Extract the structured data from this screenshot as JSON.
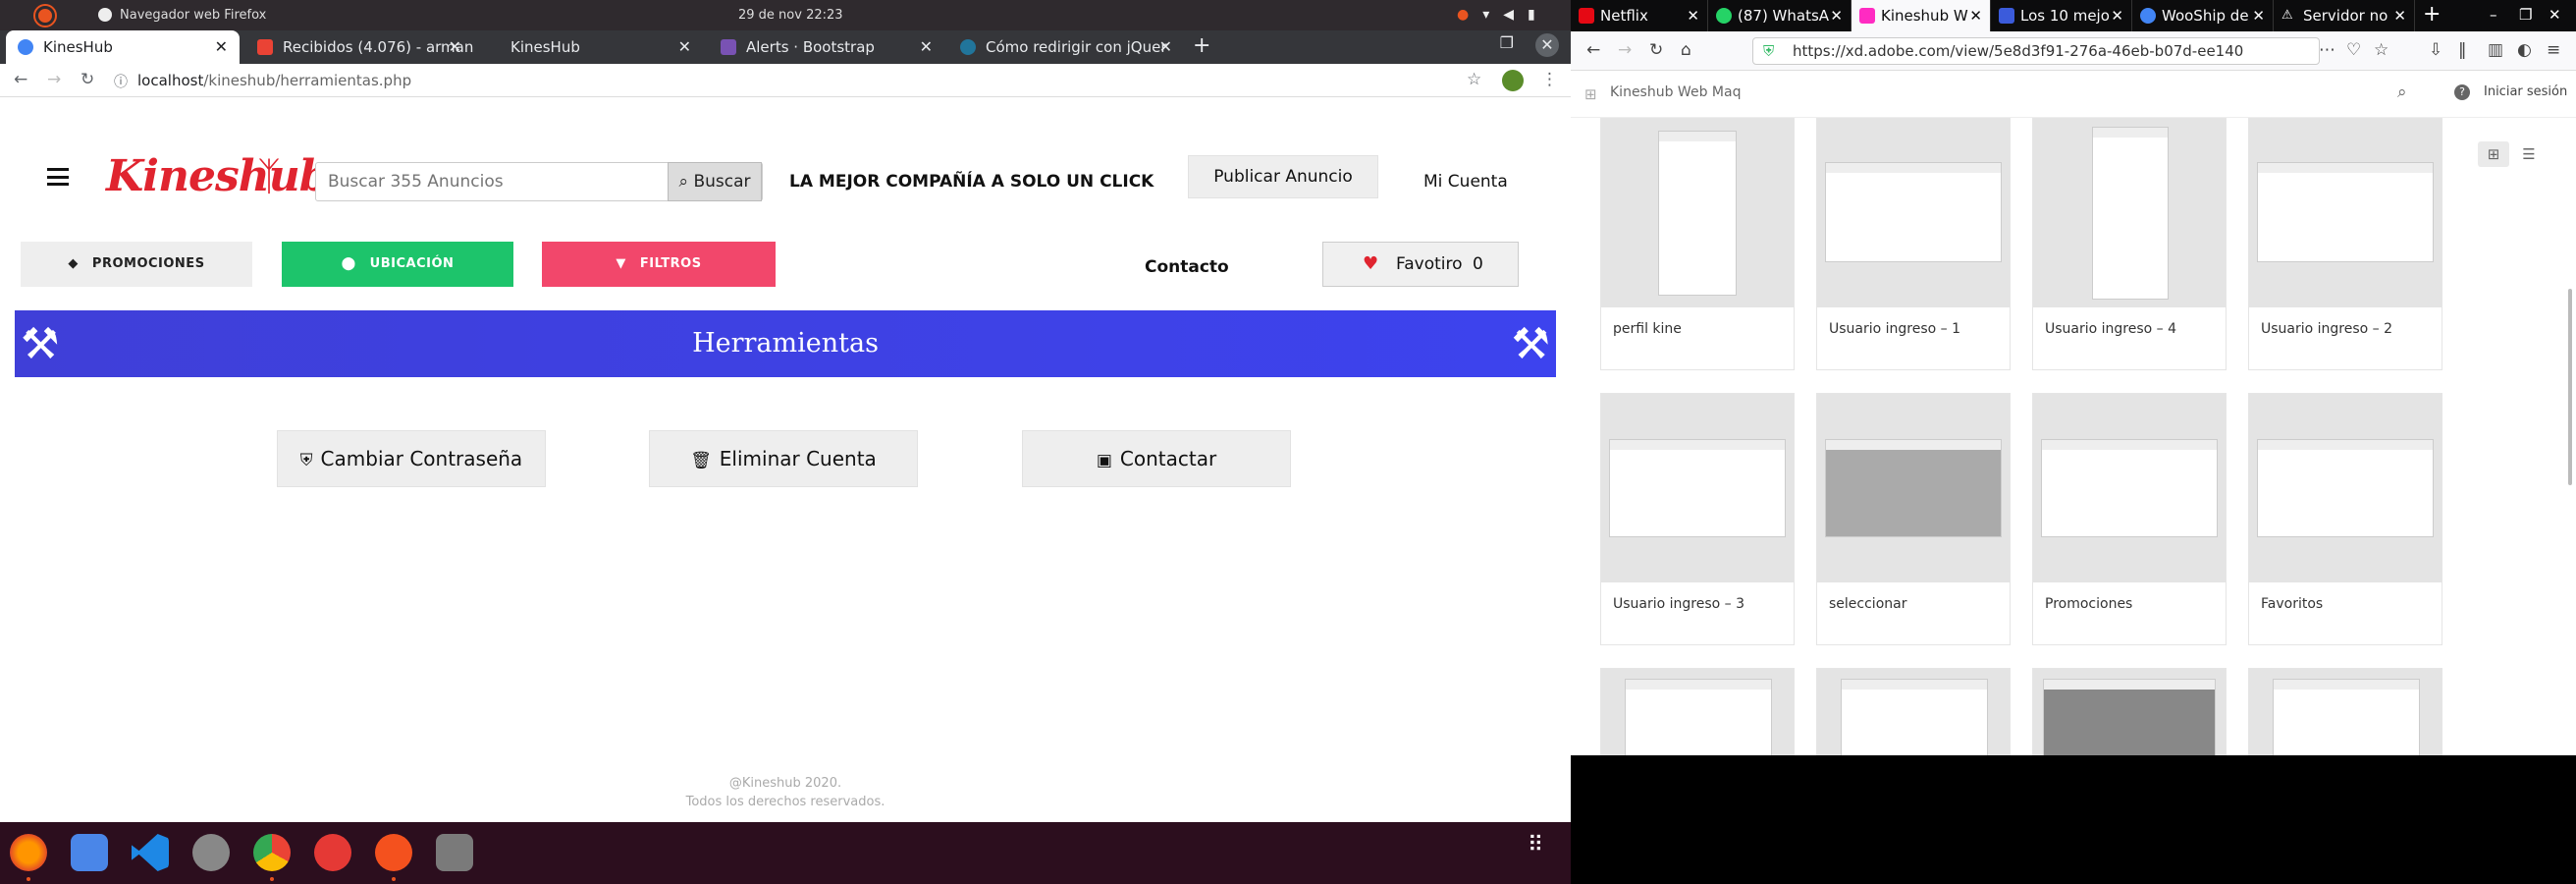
{
  "os": {
    "window_title": "Navegador web Firefox",
    "clock": "29 de nov  22:23"
  },
  "chrome": {
    "tabs": [
      {
        "label": "KinesHub",
        "color": "#4285f4",
        "active": true
      },
      {
        "label": "Recibidos (4.076) - arman",
        "color": "#ea4335"
      },
      {
        "label": "KinesHub",
        "color": "#666"
      },
      {
        "label": "Alerts · Bootstrap",
        "color": "#7952b3"
      },
      {
        "label": "Cómo redirigir con jQuer",
        "color": "#21759b"
      }
    ],
    "url_host": "localhost",
    "url_path": "/kineshub/herramientas.php"
  },
  "site": {
    "logo": "Kineshub",
    "search_placeholder": "Buscar 355 Anuncios",
    "search_button": "Buscar",
    "slogan": "LA MEJOR COMPAÑÍA A SOLO UN CLICK",
    "publish_button": "Publicar Anuncio",
    "account_link": "Mi Cuenta",
    "promo_button": "PROMOCIONES",
    "location_button": "UBICACIÓN",
    "filters_button": "FILTROS",
    "contact_link": "Contacto",
    "favorites_label": "Favotiro",
    "favorites_count": "0",
    "banner_title": "Herramientas",
    "actions": [
      "Cambiar Contraseña",
      "Eliminar Cuenta",
      "Contactar"
    ],
    "footer_line1": "@Kineshub 2020.",
    "footer_line2": "Todos los derechos reservados.",
    "colors": {
      "brand_red": "#e0242f",
      "green": "#1dc46b",
      "pink": "#f2476b",
      "blue": "#3f3fd8"
    }
  },
  "firefox": {
    "tabs": [
      {
        "label": "Netflix",
        "color": "#e50914"
      },
      {
        "label": "(87) WhatsA",
        "color": "#25d366"
      },
      {
        "label": "Kineshub W",
        "color": "#ff2bc2",
        "active": true
      },
      {
        "label": "Los 10 mejo",
        "color": "#3b5bdb"
      },
      {
        "label": "WooShip de",
        "color": "#4285f4"
      },
      {
        "label": "Servidor no",
        "color": "#999"
      }
    ],
    "url": "https://xd.adobe.com/view/5e8d3f91-276a-46eb-b07d-ee140",
    "xd_title": "Kineshub Web Maq",
    "login": "Iniciar sesión",
    "artboards": [
      "perfil kine",
      "Usuario ingreso – 1",
      "Usuario ingreso – 4",
      "Usuario ingreso – 2",
      "Usuario ingreso – 3",
      "seleccionar",
      "Promociones",
      "Favoritos"
    ]
  }
}
